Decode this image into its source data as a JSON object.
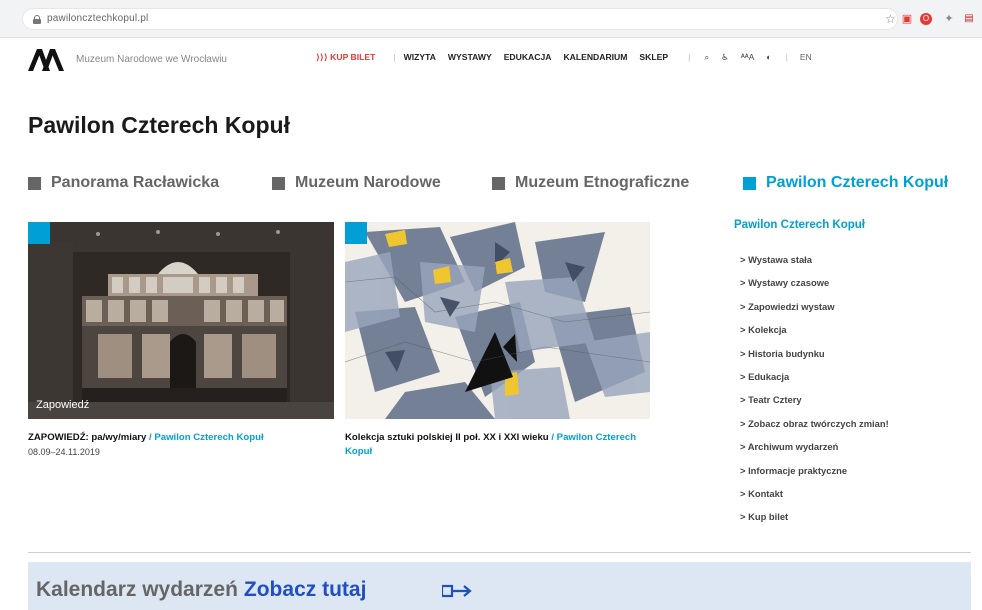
{
  "browser": {
    "url": "pawiloncztechkopul.pl"
  },
  "header": {
    "site_name": "Muzeum Narodowe we Wrocławiu",
    "nav": {
      "ticket": "⟩⟩⟩ KUP BILET",
      "items": [
        "WIZYTA",
        "WYSTAWY",
        "EDUKACJA",
        "KALENDARIUM",
        "SKLEP"
      ],
      "contrast_label": "ᴬA",
      "font_size_label": "ᴬᴬA",
      "lang": "EN"
    }
  },
  "page": {
    "title": "Pawilon Czterech Kopuł"
  },
  "tabs": [
    {
      "label": "Panorama Racławicka",
      "active": false
    },
    {
      "label": "Muzeum Narodowe",
      "active": false
    },
    {
      "label": "Muzeum Etnograficzne",
      "active": false
    },
    {
      "label": "Pawilon Czterech Kopuł",
      "active": true
    }
  ],
  "cards": [
    {
      "badge": "Zapowiedź",
      "title": "ZAPOWIEDŹ: pa/wy/miary",
      "link": " / Pawilon Czterech Kopuł",
      "date": "08.09–24.11.2019"
    },
    {
      "title": "Kolekcja sztuki polskiej II poł. XX i XXI wieku",
      "link": " / Pawilon Czterech Kopuł"
    }
  ],
  "sidebar": {
    "title": "Pawilon Czterech Kopuł",
    "items": [
      "> Wystawa stała",
      "> Wystawy czasowe",
      "> Zapowiedzi wystaw",
      "> Kolekcja",
      "> Historia budynku",
      "> Edukacja",
      "> Teatr Cztery",
      "> Zobacz obraz twórczych zmian!",
      "> Archiwum wydarzeń",
      "> Informacje praktyczne",
      "> Kontakt",
      "> Kup bilet"
    ]
  },
  "calendar": {
    "label": "Kalendarz wydarzeń",
    "cta": "Zobacz tutaj"
  },
  "colors": {
    "accent": "#00a0d6",
    "ticket": "#e53935",
    "cta": "#1f4fc2",
    "calendar_bg": "#dde7f3"
  }
}
